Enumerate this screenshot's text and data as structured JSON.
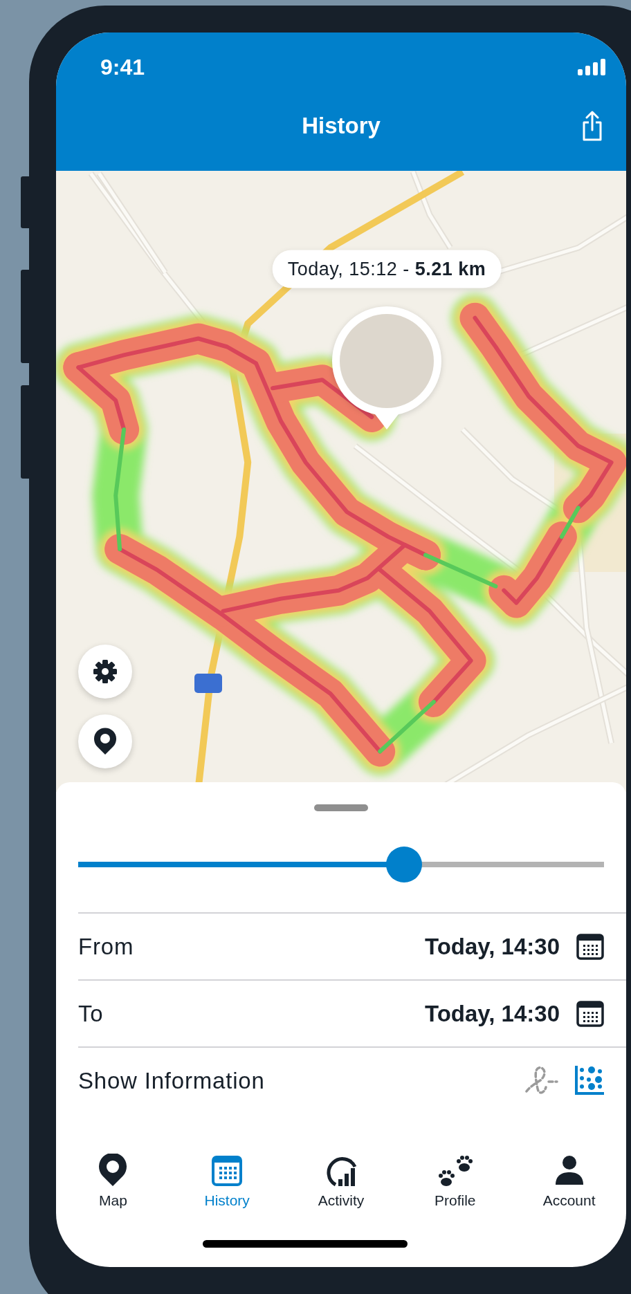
{
  "status_bar": {
    "time": "9:41"
  },
  "header": {
    "title": "History"
  },
  "map": {
    "tooltip": "Today, 15:12 - **5.21 km**"
  },
  "time_slider": {
    "level": 0.62
  },
  "range": [
    {
      "label": "From",
      "value": "Today, 14:30"
    },
    {
      "label": "To",
      "value": "Today, 14:30"
    }
  ],
  "show_information": {
    "label": "Show Information",
    "modes": [
      {
        "kind": "route",
        "selected": false
      },
      {
        "kind": "heatmap",
        "selected": true
      }
    ]
  },
  "tabs": [
    {
      "kind": "map",
      "label": "Map",
      "selected": false
    },
    {
      "kind": "history",
      "label": "History",
      "selected": true
    },
    {
      "kind": "activity",
      "label": "Activity",
      "selected": false
    },
    {
      "kind": "profile",
      "label": "Profile",
      "selected": false
    },
    {
      "kind": "account",
      "label": "Account",
      "selected": false
    }
  ]
}
